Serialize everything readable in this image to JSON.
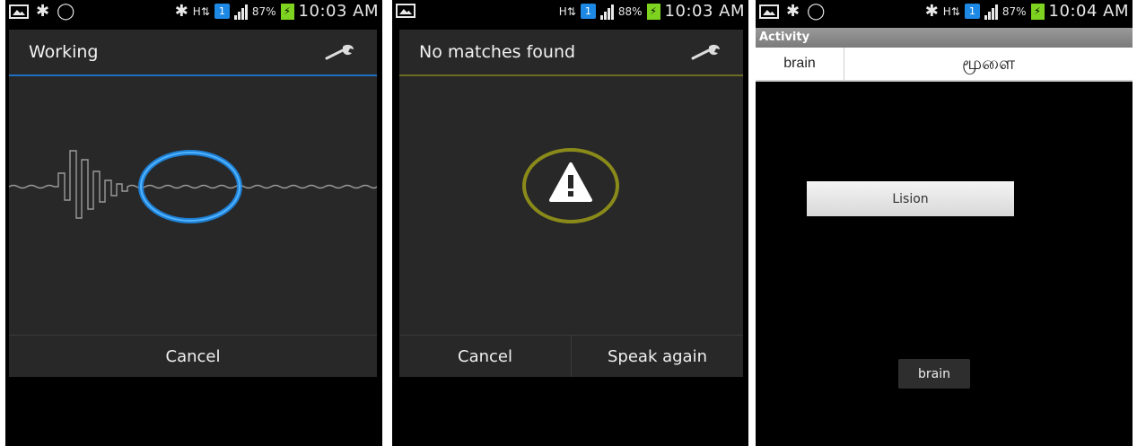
{
  "screens": [
    {
      "status": {
        "battery_pct": "87%",
        "time": "10:03 AM"
      },
      "dialog": {
        "title": "Working",
        "cancel_label": "Cancel"
      }
    },
    {
      "status": {
        "battery_pct": "88%",
        "time": "10:03 AM"
      },
      "dialog": {
        "title": "No matches found",
        "cancel_label": "Cancel",
        "speak_again_label": "Speak again"
      }
    },
    {
      "status": {
        "battery_pct": "87%",
        "time": "10:04 AM"
      },
      "activity": {
        "title": "Activity",
        "row": {
          "word": "brain",
          "translation": "மூளை"
        },
        "lision_label": "Lision",
        "brain_button_label": "brain"
      }
    }
  ],
  "colors": {
    "accent_blue": "#1e88e5",
    "warning_olive": "#8a8a1a",
    "dialog_bg": "#282828"
  },
  "icons": [
    "picture-icon",
    "bluetooth-icon",
    "whatsapp-icon",
    "data-transfer-icon",
    "notification-badge-icon",
    "signal-icon",
    "battery-charging-icon",
    "wrench-icon",
    "warning-icon"
  ]
}
